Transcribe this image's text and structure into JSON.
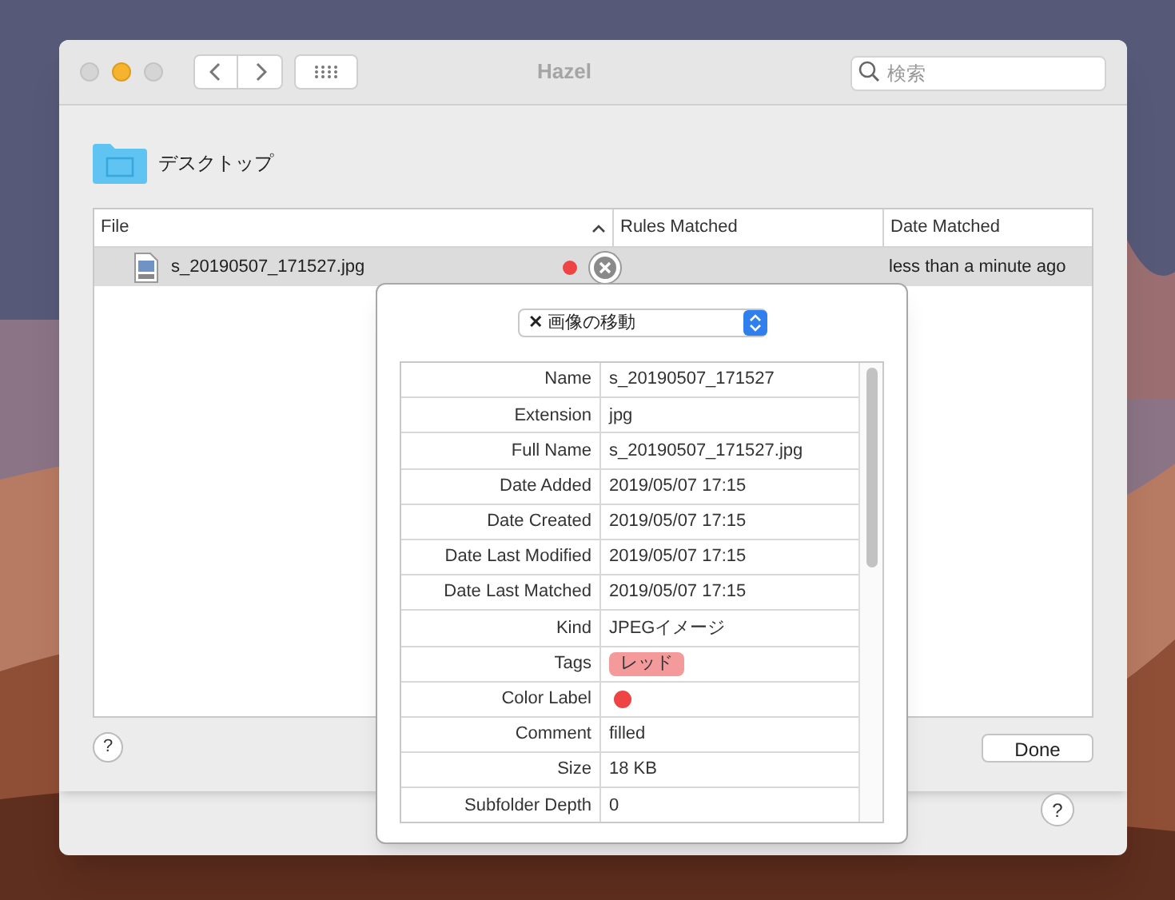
{
  "window": {
    "title": "Hazel"
  },
  "search": {
    "placeholder": "検索"
  },
  "folder": {
    "name": "デスクトップ"
  },
  "table": {
    "columns": [
      {
        "label": "File",
        "sorted": true
      },
      {
        "label": "Rules Matched",
        "sorted": false
      },
      {
        "label": "Date Matched",
        "sorted": false
      }
    ],
    "rows": [
      {
        "file": "s_20190507_171527.jpg",
        "color": "#ee4444",
        "rules_matched": "",
        "date_matched": "less than a minute ago",
        "selected": true
      }
    ]
  },
  "popover": {
    "rule": "画像の移動",
    "properties": [
      {
        "kind": "text",
        "name": "Name",
        "value": "s_20190507_171527"
      },
      {
        "kind": "text",
        "name": "Extension",
        "value": "jpg"
      },
      {
        "kind": "text",
        "name": "Full Name",
        "value": "s_20190507_171527.jpg"
      },
      {
        "kind": "text",
        "name": "Date Added",
        "value": "2019/05/07 17:15"
      },
      {
        "kind": "text",
        "name": "Date Created",
        "value": "2019/05/07 17:15"
      },
      {
        "kind": "text",
        "name": "Date Last Modified",
        "value": "2019/05/07 17:15"
      },
      {
        "kind": "text",
        "name": "Date Last Matched",
        "value": "2019/05/07 17:15"
      },
      {
        "kind": "text",
        "name": "Kind",
        "value": "JPEGイメージ"
      },
      {
        "kind": "tag",
        "name": "Tags",
        "value": "レッド",
        "color": "#f49a9a"
      },
      {
        "kind": "color",
        "name": "Color Label",
        "color": "#ef4444"
      },
      {
        "kind": "text",
        "name": "Comment",
        "value": "filled"
      },
      {
        "kind": "text",
        "name": "Size",
        "value": "18 KB"
      },
      {
        "kind": "text",
        "name": "Subfolder Depth",
        "value": "0"
      }
    ]
  },
  "buttons": {
    "done": "Done",
    "help": "?",
    "window_help": "?",
    "rule_icon": "✕"
  }
}
